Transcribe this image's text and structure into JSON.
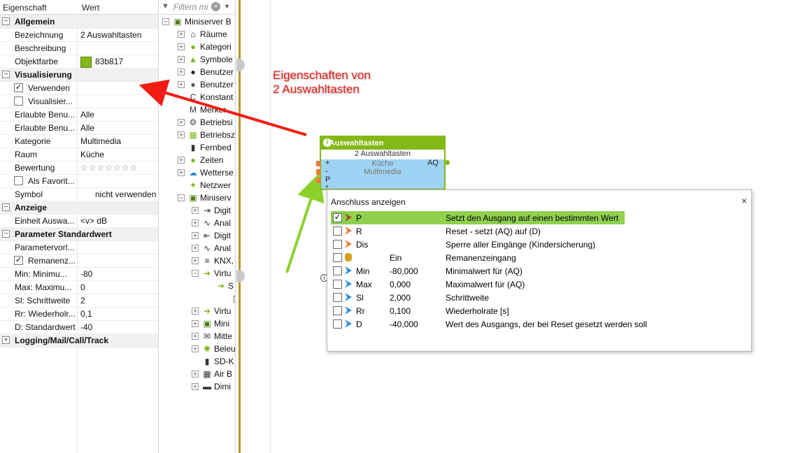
{
  "props": {
    "header": {
      "property": "Eigenschaft",
      "value": "Wert"
    },
    "rows": [
      {
        "type": "cat",
        "label": "Allgemein"
      },
      {
        "label": "Bezeichnung",
        "value": "2 Auswahltasten"
      },
      {
        "label": "Beschreibung",
        "value": ""
      },
      {
        "label": "Objektfarbe",
        "value": "83b817",
        "color": "#83b817"
      },
      {
        "type": "cat",
        "label": "Visualisierung"
      },
      {
        "type": "check",
        "label": "Verwenden",
        "checked": true
      },
      {
        "type": "check",
        "label": "Visualisier...",
        "checked": false
      },
      {
        "label": "Erlaubte Benu...",
        "value": "Alle"
      },
      {
        "label": "Erlaubte Benu...",
        "value": "Alle"
      },
      {
        "label": "Kategorie",
        "value": "Multimedia"
      },
      {
        "label": "Raum",
        "value": "Küche"
      },
      {
        "label": "Bewertung",
        "value": "☆☆☆☆☆☆☆"
      },
      {
        "type": "check",
        "label": "Als Favorit...",
        "checked": false
      },
      {
        "label": "Symbol",
        "value": "nicht verwenden"
      },
      {
        "type": "cat",
        "label": "Anzeige"
      },
      {
        "label": "Einheit Auswa...",
        "value": "<v> dB"
      },
      {
        "type": "cat",
        "label": "Parameter Standardwert"
      },
      {
        "label": "Parametervorl...",
        "value": ""
      },
      {
        "type": "check",
        "label": "Remanenz...",
        "checked": true
      },
      {
        "label": "Min: Minimu...",
        "value": "-80"
      },
      {
        "label": "Max: Maximu...",
        "value": "0"
      },
      {
        "label": "Sl: Schrittweite",
        "value": "2"
      },
      {
        "label": "Rr: Wiederholr...",
        "value": "0,1"
      },
      {
        "label": "D: Standardwert",
        "value": "-40"
      },
      {
        "type": "cat",
        "label": "Logging/Mail/Call/Track"
      }
    ]
  },
  "tree": {
    "filter_placeholder": "Filtern mi",
    "nodes": [
      {
        "label": "Miniserver B",
        "icon": "miniserver-icon",
        "level": 0
      },
      {
        "label": "Räume",
        "icon": "home-icon",
        "level": 1
      },
      {
        "label": "Kategori",
        "icon": "category-icon",
        "level": 1
      },
      {
        "label": "Symbole",
        "icon": "image-icon",
        "level": 1
      },
      {
        "label": "Benutzer",
        "icon": "user-icon",
        "level": 1
      },
      {
        "label": "Benutzer",
        "icon": "users-icon",
        "level": 1
      },
      {
        "label": "Konstant",
        "icon": "constant-icon",
        "level": 1
      },
      {
        "label": "Merker",
        "icon": "flag-icon",
        "level": 1
      },
      {
        "label": "Betriebsi",
        "icon": "gear-icon",
        "level": 1
      },
      {
        "label": "Betriebsz",
        "icon": "calendar-icon",
        "level": 1
      },
      {
        "label": "Fernbed",
        "icon": "remote-icon",
        "level": 1
      },
      {
        "label": "Zeiten",
        "icon": "clock-icon",
        "level": 1
      },
      {
        "label": "Wetterse",
        "icon": "weather-icon",
        "level": 1
      },
      {
        "label": "Netzwer",
        "icon": "network-icon",
        "level": 1
      },
      {
        "label": "Miniserv",
        "icon": "miniserver-icon",
        "level": 1
      },
      {
        "label": "Digit",
        "icon": "digital-input-icon",
        "level": 2
      },
      {
        "label": "Anal",
        "icon": "analog-input-icon",
        "level": 2
      },
      {
        "label": "Digit",
        "icon": "digital-output-icon",
        "level": 2
      },
      {
        "label": "Anal",
        "icon": "analog-output-icon",
        "level": 2
      },
      {
        "label": "KNX,",
        "icon": "knx-icon",
        "level": 2
      },
      {
        "label": "Virtu",
        "icon": "virtual-input-icon",
        "level": 2
      },
      {
        "label": "S",
        "icon": "virtual-input-icon",
        "level": 3
      },
      {
        "label": "",
        "icon": "leaf-icon",
        "level": 4
      },
      {
        "label": "Virtu",
        "icon": "virtual-output-icon",
        "level": 2
      },
      {
        "label": "Mini",
        "icon": "miniserver-icon",
        "level": 2
      },
      {
        "label": "Mitte",
        "icon": "message-icon",
        "level": 2
      },
      {
        "label": "Beleu",
        "icon": "light-icon",
        "level": 2
      },
      {
        "label": "SD-K",
        "icon": "sdcard-icon",
        "level": 2
      },
      {
        "label": "Air B",
        "icon": "air-icon",
        "level": 2
      },
      {
        "label": "Dimi",
        "icon": "dimmer-icon",
        "level": 2
      }
    ]
  },
  "annotation": {
    "line1": "Eigenschaften von",
    "line2": "2 Auswahltasten"
  },
  "block": {
    "title": "2 Auswahltasten",
    "subtitle": "2 Auswahltasten",
    "room": "Küche",
    "category": "Multimedia",
    "inputs": [
      "+",
      "-",
      "P",
      "+"
    ],
    "output": "AQ"
  },
  "popup": {
    "title": "Anschluss anzeigen",
    "close": "×",
    "rows": [
      {
        "name": "P",
        "value": "",
        "desc": "Setzt den Ausgang auf einen bestimmten Wert",
        "icon": "brown",
        "checked": true,
        "selected": true
      },
      {
        "name": "R",
        "value": "",
        "desc": "Reset - setzt (AQ) auf (D)",
        "icon": "orange",
        "checked": false
      },
      {
        "name": "Dis",
        "value": "",
        "desc": "Sperre aller Eingänge (Kindersicherung)",
        "icon": "orange",
        "checked": false
      },
      {
        "name": "",
        "value": "Ein",
        "desc": "Remanenzeingang",
        "icon": "db",
        "checked": false
      },
      {
        "name": "Min",
        "value": "-80,000",
        "desc": "Minimalwert für (AQ)",
        "icon": "blue",
        "checked": false
      },
      {
        "name": "Max",
        "value": "0,000",
        "desc": "Maximalwert für (AQ)",
        "icon": "blue",
        "checked": false
      },
      {
        "name": "Sl",
        "value": "2,000",
        "desc": "Schrittweite",
        "icon": "blue",
        "checked": false
      },
      {
        "name": "Rr",
        "value": "0,100",
        "desc": "Wiederholrate [s]",
        "icon": "blue",
        "checked": false
      },
      {
        "name": "D",
        "value": "-40,000",
        "desc": "Wert des Ausgangs, der bei Reset gesetzt werden soll",
        "icon": "blue",
        "checked": false
      }
    ]
  },
  "colors": {
    "accent": "#83b817",
    "annotation": "#e8201a",
    "canvas_border": "#b8952e",
    "block_body": "#9fd3f3"
  }
}
